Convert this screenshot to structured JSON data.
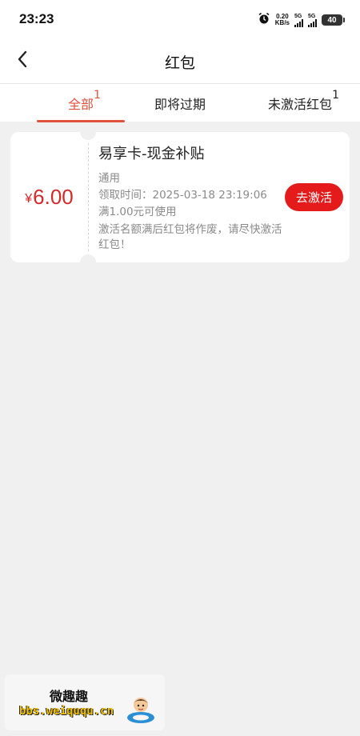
{
  "status_bar": {
    "time": "23:23",
    "net_speed_value": "0.20",
    "net_speed_unit": "KB/s",
    "sim1_label": "5G",
    "sim2_label": "5G",
    "battery_level": "40"
  },
  "header": {
    "title": "红包",
    "back_icon": "chevron-left-icon"
  },
  "tabs": [
    {
      "label": "全部",
      "count": "1",
      "active": true
    },
    {
      "label": "即将过期",
      "count": "",
      "active": false
    },
    {
      "label": "未激活红包",
      "count": "1",
      "active": false
    }
  ],
  "coupons": [
    {
      "currency": "¥",
      "amount": "6.00",
      "title": "易享卡-现金补贴",
      "scope": "通用",
      "received_time": "领取时间：2025-03-18 23:19:06",
      "threshold": "满1.00元可使用",
      "note": "激活名额满后红包将作废，请尽快激活红包！",
      "action_label": "去激活"
    }
  ],
  "watermark": {
    "brand": "微趣趣",
    "url": "bbs.weiququ.cn"
  },
  "colors": {
    "accent": "#e0523e",
    "amount": "#d32a2a",
    "button": "#e51b1b",
    "background": "#f0f0f0"
  }
}
